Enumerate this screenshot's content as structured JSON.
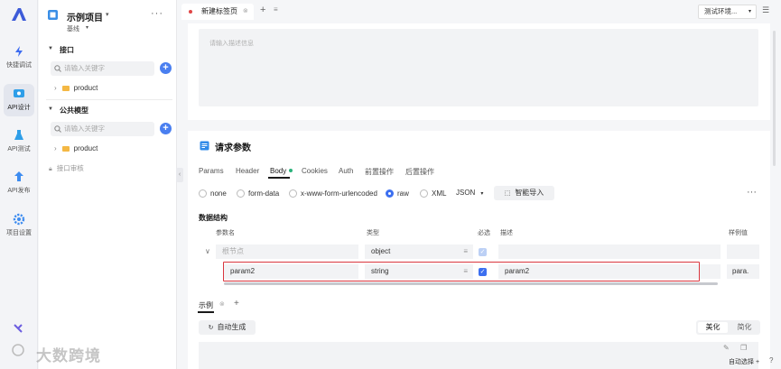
{
  "rail": {
    "items": [
      {
        "label": "快捷调试",
        "icon": "lightning-icon"
      },
      {
        "label": "API设计",
        "icon": "api-design-icon"
      },
      {
        "label": "API测试",
        "icon": "flask-icon"
      },
      {
        "label": "API发布",
        "icon": "publish-icon"
      },
      {
        "label": "项目设置",
        "icon": "gear-icon"
      }
    ]
  },
  "project": {
    "name": "示例项目",
    "branch": "基线",
    "interfaces_title": "接口",
    "search_placeholder": "请输入关键字",
    "interfaces_tree": [
      "product"
    ],
    "models_title": "公共模型",
    "models_tree": [
      "product"
    ],
    "review": "接口审核"
  },
  "tabs": {
    "active": "新建标签页",
    "env": "测试环境..."
  },
  "desc_placeholder": "请输入描述信息",
  "request": {
    "title": "请求参数",
    "tabs": [
      "Params",
      "Header",
      "Body",
      "Cookies",
      "Auth",
      "前置操作",
      "后置操作"
    ],
    "body_types": [
      "none",
      "form-data",
      "x-www-form-urlencoded",
      "raw",
      "XML"
    ],
    "selected_body_type": "raw",
    "format": "JSON",
    "smart_import": "智能导入",
    "structure_title": "数据结构",
    "columns": [
      "参数名",
      "类型",
      "必选",
      "描述",
      "样例值"
    ],
    "rows": [
      {
        "name": "根节点",
        "type": "object",
        "required": true,
        "desc": "",
        "sample": ""
      },
      {
        "name": "param2",
        "type": "string",
        "required": true,
        "desc": "param2",
        "sample": "para."
      }
    ]
  },
  "example": {
    "tab": "示例",
    "auto_gen": "自动生成",
    "beautify": "美化",
    "simplify": "简化"
  },
  "footer": {
    "auto_select": "自动选择"
  },
  "watermark": "大数跨境",
  "colors": {
    "accent": "#3c6ff0",
    "highlight": "#d9363e",
    "brand": "#4a7ff0"
  }
}
